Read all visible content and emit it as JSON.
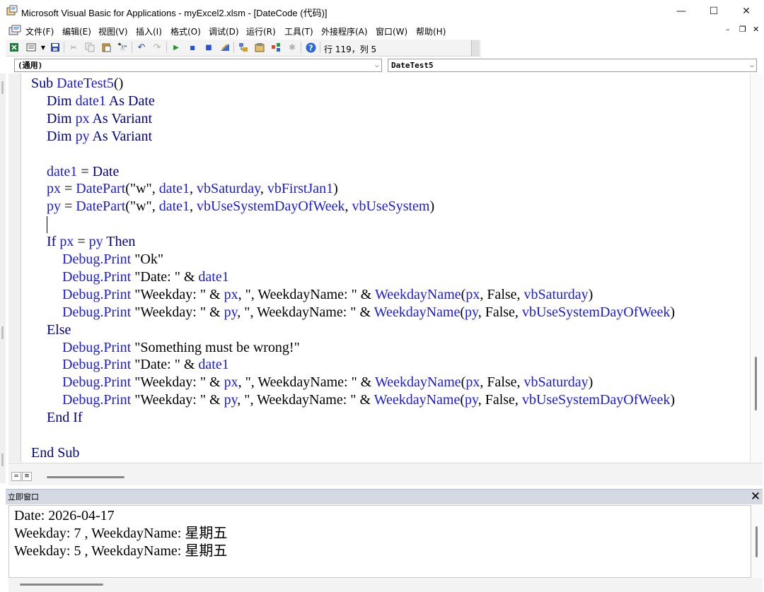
{
  "window": {
    "title": "Microsoft Visual Basic for Applications - myExcel2.xlsm - [DateCode (代码)]",
    "minimize_glyph": "—",
    "maximize_glyph": "☐",
    "close_glyph": "✕"
  },
  "menu": {
    "items": [
      "文件(F)",
      "编辑(E)",
      "视图(V)",
      "插入(I)",
      "格式(O)",
      "调试(D)",
      "运行(R)",
      "工具(T)",
      "外接程序(A)",
      "窗口(W)",
      "帮助(H)"
    ],
    "mdi_minimize": "–",
    "mdi_restore": "❐",
    "mdi_close": "✕"
  },
  "toolbar": {
    "cursor_position": "行 119，列 5",
    "icons": [
      "excel-icon",
      "insert-module-icon",
      "save-icon",
      "cut-icon",
      "copy-icon",
      "paste-icon",
      "find-icon",
      "undo-icon",
      "redo-icon",
      "run-icon",
      "break-icon",
      "reset-icon",
      "design-mode-icon",
      "project-explorer-icon",
      "properties-icon",
      "object-browser-icon",
      "toolbox-icon",
      "help-icon"
    ]
  },
  "combos": {
    "object": "(通用)",
    "procedure": "DateTest5"
  },
  "code": {
    "lines": [
      {
        "indent": 0,
        "parts": [
          [
            "kw",
            "Sub "
          ],
          [
            "nm",
            "DateTest5"
          ],
          [
            "tx",
            "()"
          ]
        ]
      },
      {
        "indent": 1,
        "parts": [
          [
            "kw",
            "Dim "
          ],
          [
            "nm",
            "date1"
          ],
          [
            "kw",
            " As Date"
          ]
        ]
      },
      {
        "indent": 1,
        "parts": [
          [
            "kw",
            "Dim "
          ],
          [
            "nm",
            "px"
          ],
          [
            "kw",
            " As Variant"
          ]
        ]
      },
      {
        "indent": 1,
        "parts": [
          [
            "kw",
            "Dim "
          ],
          [
            "nm",
            "py"
          ],
          [
            "kw",
            " As Variant"
          ]
        ]
      },
      {
        "indent": 0,
        "parts": []
      },
      {
        "indent": 1,
        "parts": [
          [
            "nm",
            "date1"
          ],
          [
            "tx",
            " = "
          ],
          [
            "kw",
            "Date"
          ]
        ]
      },
      {
        "indent": 1,
        "parts": [
          [
            "nm",
            "px"
          ],
          [
            "tx",
            " = "
          ],
          [
            "nm",
            "DatePart"
          ],
          [
            "tx",
            "(\"w\", "
          ],
          [
            "nm",
            "date1"
          ],
          [
            "tx",
            ", "
          ],
          [
            "nm",
            "vbSaturday"
          ],
          [
            "tx",
            ", "
          ],
          [
            "nm",
            "vbFirstJan1"
          ],
          [
            "tx",
            ")"
          ]
        ]
      },
      {
        "indent": 1,
        "parts": [
          [
            "nm",
            "py"
          ],
          [
            "tx",
            " = "
          ],
          [
            "nm",
            "DatePart"
          ],
          [
            "tx",
            "(\"w\", "
          ],
          [
            "nm",
            "date1"
          ],
          [
            "tx",
            ", "
          ],
          [
            "nm",
            "vbUseSystemDayOfWeek"
          ],
          [
            "tx",
            ", "
          ],
          [
            "nm",
            "vbUseSystem"
          ],
          [
            "tx",
            ")"
          ]
        ]
      },
      {
        "indent": 0,
        "parts": []
      },
      {
        "indent": 1,
        "parts": [
          [
            "kw",
            "If "
          ],
          [
            "nm",
            "px"
          ],
          [
            "tx",
            " = "
          ],
          [
            "nm",
            "py"
          ],
          [
            "kw",
            " Then"
          ]
        ]
      },
      {
        "indent": 2,
        "parts": [
          [
            "nm",
            "Debug.Print"
          ],
          [
            "tx",
            " \"Ok\""
          ]
        ]
      },
      {
        "indent": 2,
        "parts": [
          [
            "nm",
            "Debug.Print"
          ],
          [
            "tx",
            " \"Date: \" & "
          ],
          [
            "nm",
            "date1"
          ]
        ]
      },
      {
        "indent": 2,
        "parts": [
          [
            "nm",
            "Debug.Print"
          ],
          [
            "tx",
            " \"Weekday: \" & "
          ],
          [
            "nm",
            "px"
          ],
          [
            "tx",
            ", \", WeekdayName: \" & "
          ],
          [
            "nm",
            "WeekdayName"
          ],
          [
            "tx",
            "("
          ],
          [
            "nm",
            "px"
          ],
          [
            "tx",
            ", False, "
          ],
          [
            "nm",
            "vbSaturday"
          ],
          [
            "tx",
            ")"
          ]
        ]
      },
      {
        "indent": 2,
        "parts": [
          [
            "nm",
            "Debug.Print"
          ],
          [
            "tx",
            " \"Weekday: \" & "
          ],
          [
            "nm",
            "py"
          ],
          [
            "tx",
            ", \", WeekdayName: \" & "
          ],
          [
            "nm",
            "WeekdayName"
          ],
          [
            "tx",
            "("
          ],
          [
            "nm",
            "py"
          ],
          [
            "tx",
            ", False, "
          ],
          [
            "nm",
            "vbUseSystemDayOfWeek"
          ],
          [
            "tx",
            ")"
          ]
        ]
      },
      {
        "indent": 1,
        "parts": [
          [
            "kw",
            "Else"
          ]
        ]
      },
      {
        "indent": 2,
        "parts": [
          [
            "nm",
            "Debug.Print"
          ],
          [
            "tx",
            " \"Something must be wrong!\""
          ]
        ]
      },
      {
        "indent": 2,
        "parts": [
          [
            "nm",
            "Debug.Print"
          ],
          [
            "tx",
            " \"Date: \" & "
          ],
          [
            "nm",
            "date1"
          ]
        ]
      },
      {
        "indent": 2,
        "parts": [
          [
            "nm",
            "Debug.Print"
          ],
          [
            "tx",
            " \"Weekday: \" & "
          ],
          [
            "nm",
            "px"
          ],
          [
            "tx",
            ", \", WeekdayName: \" & "
          ],
          [
            "nm",
            "WeekdayName"
          ],
          [
            "tx",
            "("
          ],
          [
            "nm",
            "px"
          ],
          [
            "tx",
            ", False, "
          ],
          [
            "nm",
            "vbSaturday"
          ],
          [
            "tx",
            ")"
          ]
        ]
      },
      {
        "indent": 2,
        "parts": [
          [
            "nm",
            "Debug.Print"
          ],
          [
            "tx",
            " \"Weekday: \" & "
          ],
          [
            "nm",
            "py"
          ],
          [
            "tx",
            ", \", WeekdayName: \" & "
          ],
          [
            "nm",
            "WeekdayName"
          ],
          [
            "tx",
            "("
          ],
          [
            "nm",
            "py"
          ],
          [
            "tx",
            ", False, "
          ],
          [
            "nm",
            "vbUseSystemDayOfWeek"
          ],
          [
            "tx",
            ")"
          ]
        ]
      },
      {
        "indent": 1,
        "parts": [
          [
            "kw",
            "End If"
          ]
        ]
      },
      {
        "indent": 0,
        "parts": []
      },
      {
        "indent": 0,
        "parts": [
          [
            "kw",
            "End Sub"
          ]
        ]
      }
    ]
  },
  "immediate": {
    "title": "立即窗口",
    "close_glyph": "✕",
    "lines": [
      "Date: 2026-04-17",
      "Weekday: 7 , WeekdayName: 星期五",
      "Weekday: 5 , WeekdayName: 星期五"
    ]
  },
  "colors": {
    "keyword": "#00008b",
    "identifier": "#1a1ae0",
    "immediate_header": "#d4d9e2"
  }
}
